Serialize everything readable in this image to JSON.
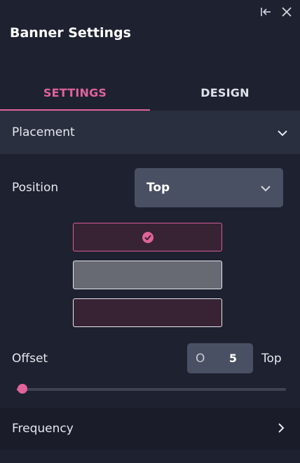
{
  "panel": {
    "title": "Banner Settings"
  },
  "header_icons": [
    "collapse-panel-icon",
    "close-icon"
  ],
  "tabs": [
    {
      "label": "SETTINGS",
      "active": true
    },
    {
      "label": "DESIGN",
      "active": false
    }
  ],
  "placement": {
    "label": "Placement",
    "position": {
      "label": "Position",
      "value": "Top"
    },
    "layout_options": [
      {
        "id": "top",
        "selected": true
      },
      {
        "id": "middle",
        "selected": false
      },
      {
        "id": "bottom",
        "selected": false
      }
    ],
    "offset": {
      "label": "Offset",
      "prefix": "O",
      "value": "5",
      "unit": "Top",
      "slider_fraction": 0.02
    }
  },
  "frequency": {
    "label": "Frequency"
  },
  "colors": {
    "accent": "#e0639a",
    "panel_bg": "#1e2130",
    "section_bg": "#2a2f3f",
    "control_bg": "#4a5064"
  }
}
